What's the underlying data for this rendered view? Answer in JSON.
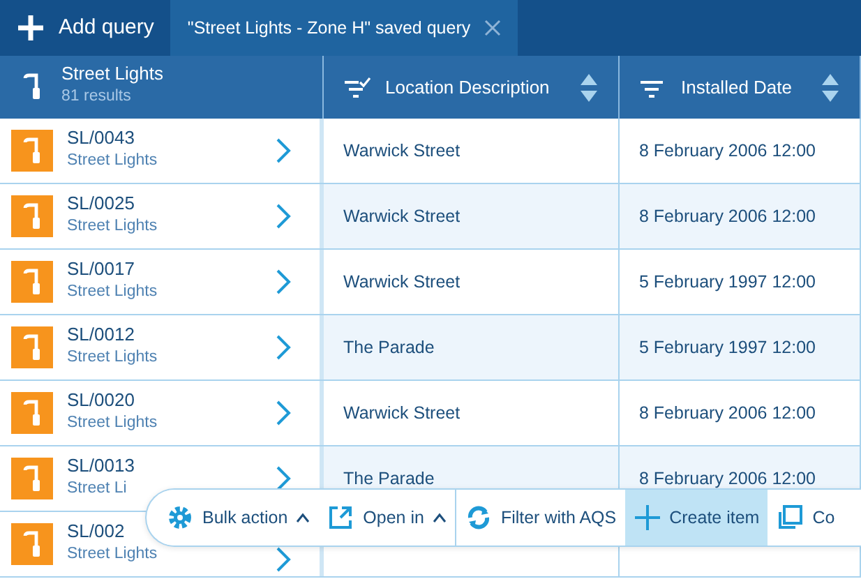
{
  "tabs": [
    {
      "kind": "add",
      "label": "Add query",
      "selected": false
    },
    {
      "kind": "query",
      "label": "\"Street Lights - Zone H\" saved query",
      "selected": true
    }
  ],
  "header": {
    "title": "Street Lights",
    "count": "81 results",
    "columns": [
      {
        "label": "Location Description",
        "filtered": true
      },
      {
        "label": "Installed Date",
        "filtered": false
      }
    ]
  },
  "rows": [
    {
      "id": "SL/0043",
      "type": "Street Lights",
      "location": "Warwick Street",
      "installed": "8 February 2006 12:00"
    },
    {
      "id": "SL/0025",
      "type": "Street Lights",
      "location": "Warwick Street",
      "installed": "8 February 2006 12:00"
    },
    {
      "id": "SL/0017",
      "type": "Street Lights",
      "location": "Warwick Street",
      "installed": "5 February 1997 12:00"
    },
    {
      "id": "SL/0012",
      "type": "Street Lights",
      "location": "The Parade",
      "installed": "5 February 1997 12:00"
    },
    {
      "id": "SL/0020",
      "type": "Street Lights",
      "location": "Warwick Street",
      "installed": "8 February 2006 12:00"
    },
    {
      "id": "SL/0013",
      "type": "Street Li",
      "location": "The Parade",
      "installed": "8 February 2006 12:00"
    },
    {
      "id": "SL/002",
      "type": "Street Lights"
    }
  ],
  "toolbar": [
    {
      "kind": "gear",
      "label": "Bulk action",
      "caret": true,
      "highlighted": false
    },
    {
      "kind": "external",
      "label": "Open in",
      "caret": true,
      "highlighted": false
    },
    {
      "kind": "refresh",
      "label": "Filter with AQS",
      "caret": false,
      "highlighted": false
    },
    {
      "kind": "plus",
      "label": "Create item",
      "caret": false,
      "highlighted": true
    },
    {
      "kind": "copy",
      "label": "Co",
      "caret": false,
      "highlighted": false
    }
  ]
}
